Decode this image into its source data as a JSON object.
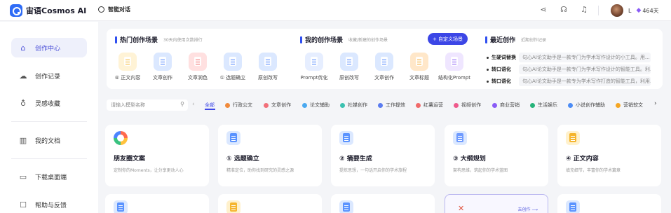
{
  "app": {
    "name": "宙语Cosmos AI",
    "page": "智能对话"
  },
  "header": {
    "icons": [
      "share-icon",
      "headset-icon",
      "bell-icon"
    ],
    "user_initial": "L",
    "credits": "464天"
  },
  "sidebar": {
    "items": [
      {
        "label": "创作中心",
        "icon": "home-icon",
        "active": true
      },
      {
        "label": "创作记录",
        "icon": "cloud-icon"
      },
      {
        "label": "灵感收藏",
        "icon": "bulb-icon"
      },
      {
        "label": "我的文档",
        "icon": "book-icon"
      },
      {
        "label": "下载桌面端",
        "icon": "monitor-icon"
      },
      {
        "label": "帮助与反馈",
        "icon": "help-icon"
      }
    ]
  },
  "hot": {
    "title": "热门创作场景",
    "subtitle": "30天内使用次数排行",
    "items": [
      "④ 正文内容",
      "文章创作",
      "文章润色",
      "① 选题确立",
      "原创改写"
    ]
  },
  "mine": {
    "title": "我的创作场景",
    "subtitle": "收藏/新建的创作场景",
    "add_label": "+ 自定义场景",
    "items": [
      "Prompt优化",
      "原创改写",
      "文章创作",
      "文章标题",
      "结构化Prompt"
    ]
  },
  "recent": {
    "title": "最近创作",
    "subtitle": "近期创作记录",
    "items": [
      {
        "tag": "生硬词替换",
        "text": "句心AI论文助手是一款专门为学术写作设计的小工具。用..."
      },
      {
        "tag": "转口语化",
        "text": "句心AI论文助手是一款专门为学术写作设计的智能工具。利..."
      },
      {
        "tag": "转口语化",
        "text": "句心AI论文助手是一款专为学术写作打造的智能工具，利用..."
      }
    ]
  },
  "filter": {
    "search_placeholder": "请输入模型名称",
    "all": "全部",
    "categories": [
      {
        "label": "行政公文",
        "color": "#f08a3c"
      },
      {
        "label": "文章创作",
        "color": "#f2707a"
      },
      {
        "label": "论文辅助",
        "color": "#4aa9f0"
      },
      {
        "label": "社媒创作",
        "color": "#3cc1b0"
      },
      {
        "label": "工作提效",
        "color": "#5b7cf0"
      },
      {
        "label": "红薯运营",
        "color": "#f06a6a"
      },
      {
        "label": "视频创作",
        "color": "#ef5a8c"
      },
      {
        "label": "商业营销",
        "color": "#8a5cf6"
      },
      {
        "label": "生活娱乐",
        "color": "#26b37a"
      },
      {
        "label": "小说创作辅助",
        "color": "#4c8cf5"
      },
      {
        "label": "营销软文",
        "color": "#f5a623"
      }
    ]
  },
  "cards": [
    {
      "title": "朋友圈文案",
      "desc": "定制你的Moments，让分享更动人心"
    },
    {
      "title": "① 选题确立",
      "desc": "精准定位，助你找到研究的灵感之源"
    },
    {
      "title": "② 摘要生成",
      "desc": "提炼思想，一句话开启你的学术旅程"
    },
    {
      "title": "③ 大纲规划",
      "desc": "架构思维，筑起你的学术蓝图"
    },
    {
      "title": "④ 正文内容",
      "desc": "填充细节，丰富你的学术篇章"
    }
  ],
  "cards_row2": {
    "goto_label": "去创作 ⟶"
  },
  "colors": {
    "accent": "#3c46e6",
    "brand": "#2f6cf6"
  }
}
